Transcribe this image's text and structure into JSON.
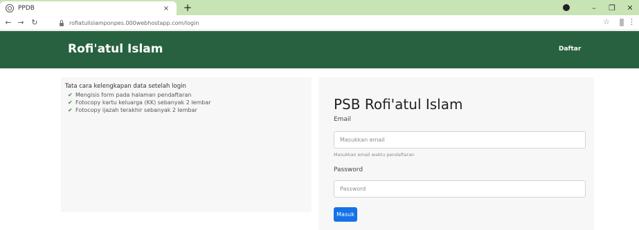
{
  "browser": {
    "tab_title": "PPDB",
    "tab_close": "×",
    "new_tab": "+",
    "url": "rofiatulislamponpes.000webhostapp.com/login",
    "window_controls": {
      "minimize": "–",
      "maximize": "❐",
      "close": "✕"
    }
  },
  "header": {
    "brand": "Rofi'atul Islam",
    "nav_register": "Daftar"
  },
  "instructions": {
    "heading": "Tata cara kelengkapan data setelah login",
    "items": [
      "Mengisis form pada halaman pendaftaran",
      "Fotocopy kartu keluarga (KK) sebanyak 2 lembar",
      "Fotocopy ijazah terakhir sebanyak 2 lembar"
    ]
  },
  "login": {
    "title": "PSB Rofi'atul Islam",
    "email_label": "Email",
    "email_placeholder": "Masukkan email",
    "email_help": "Masukkan email waktu pendaftaran",
    "password_label": "Password",
    "password_placeholder": "Password",
    "submit_label": "Masuk"
  },
  "colors": {
    "header_bg": "#28613f",
    "tabstrip_bg": "#c8e4b4",
    "button_primary": "#1572e8",
    "check_green": "#3a8a3a"
  }
}
